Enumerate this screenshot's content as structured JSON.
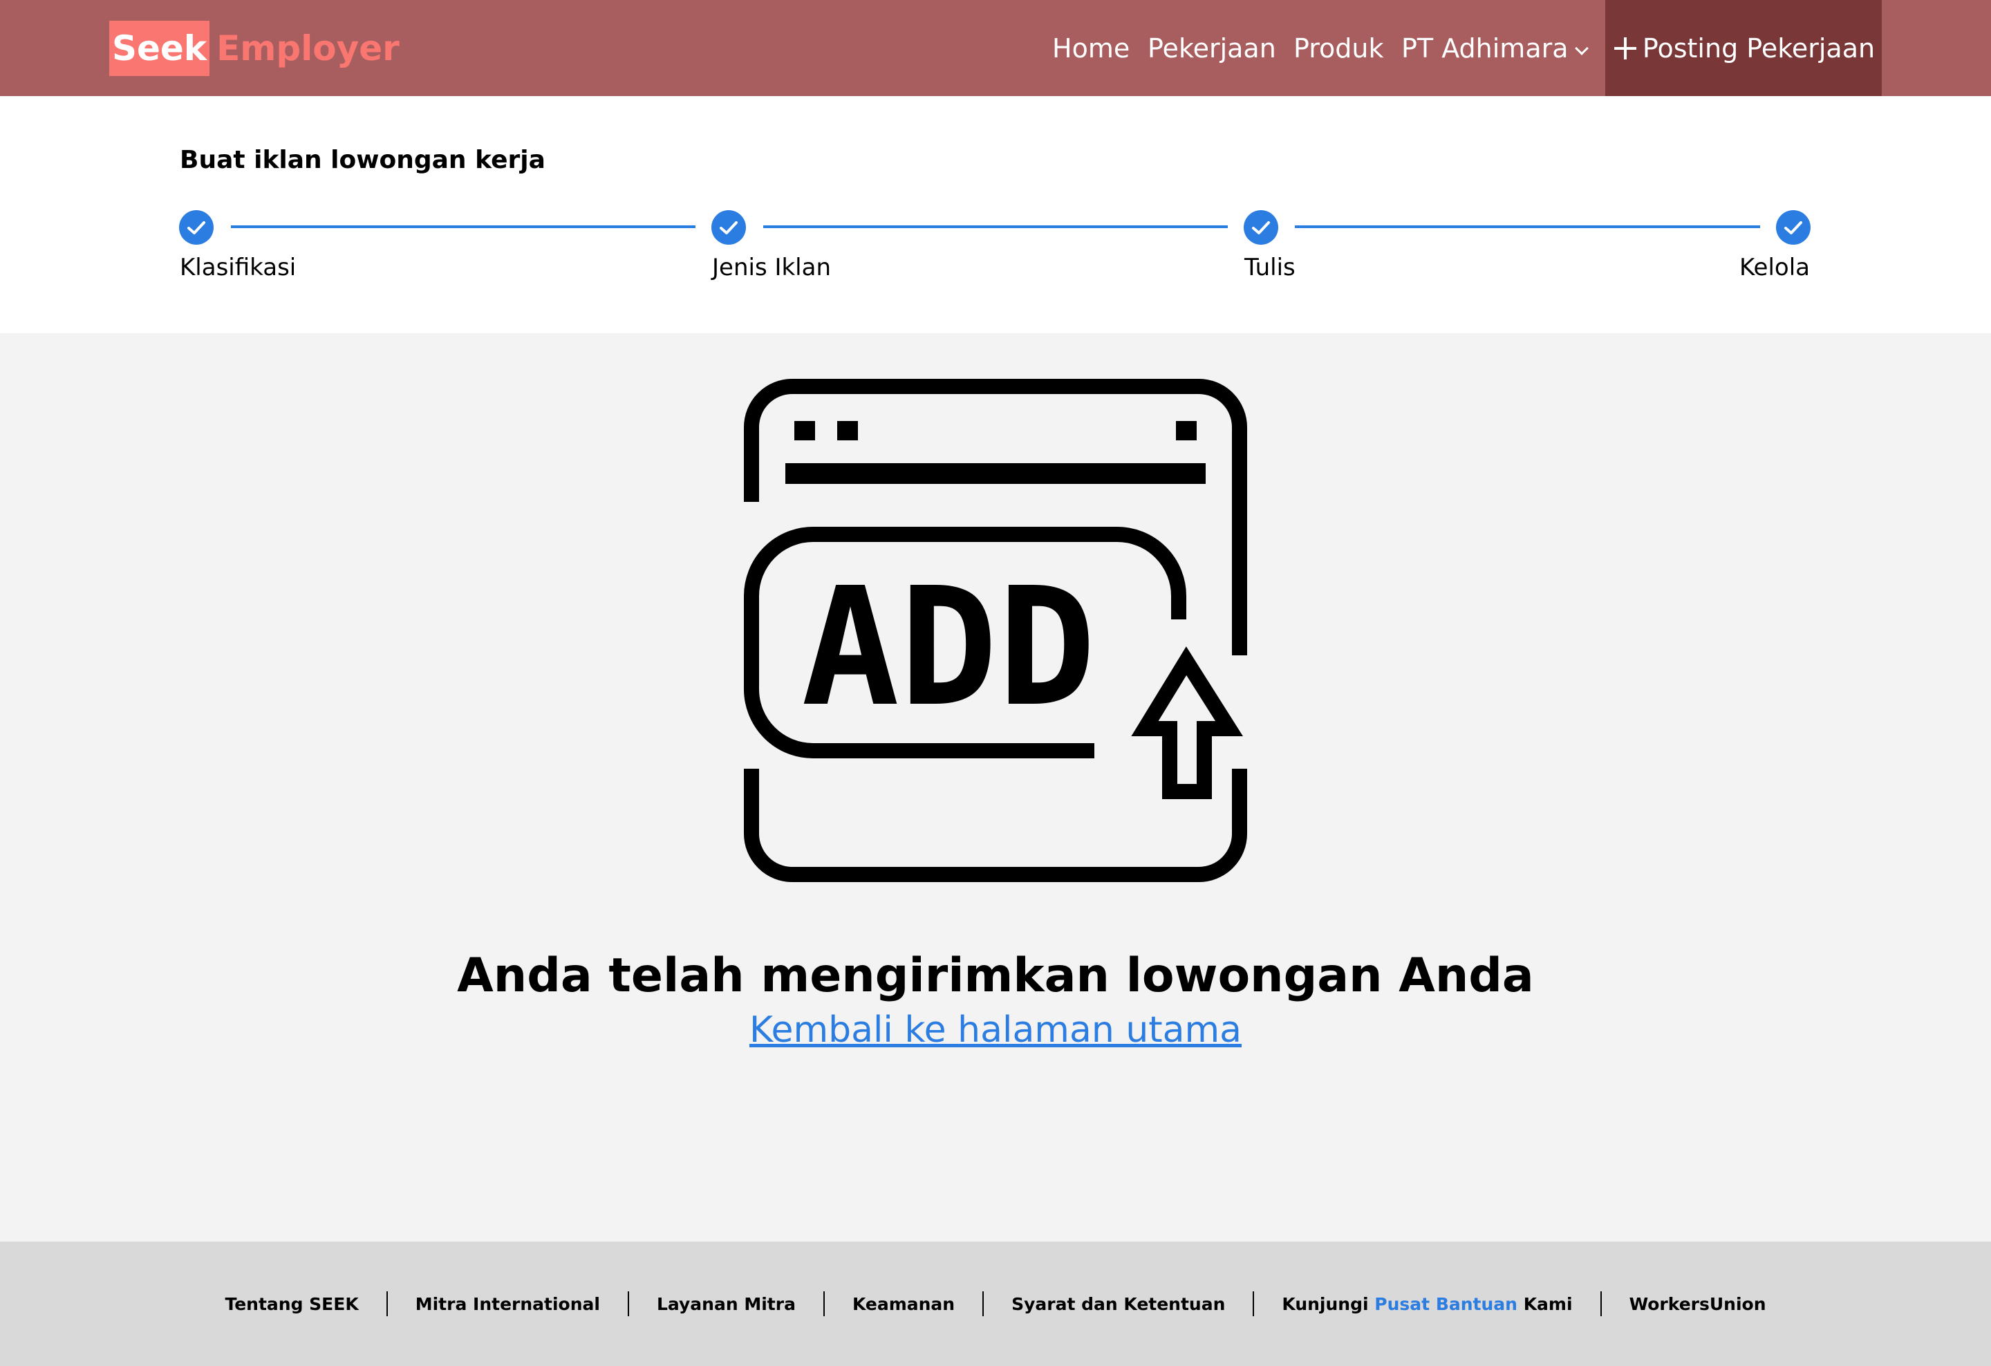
{
  "header": {
    "logo_left": "Seek",
    "logo_right": "Employer",
    "nav": {
      "home": "Home",
      "jobs": "Pekerjaan",
      "products": "Produk",
      "company": "PT Adhimara"
    },
    "post_button": "Posting Pekerjaan"
  },
  "stepper": {
    "title": "Buat iklan lowongan kerja",
    "steps": [
      {
        "label": "Klasifikasi",
        "status": "complete"
      },
      {
        "label": "Jenis Iklan",
        "status": "complete"
      },
      {
        "label": "Tulis",
        "status": "complete"
      },
      {
        "label": "Kelola",
        "status": "complete"
      }
    ]
  },
  "main": {
    "icon": "add-upload-icon",
    "icon_text": "ADD",
    "message": "Anda telah mengirimkan lowongan Anda",
    "back_link": "Kembali ke halaman utama"
  },
  "footer": {
    "links": {
      "about": "Tentang SEEK",
      "intl": "Mitra International",
      "services": "Layanan Mitra",
      "security": "Keamanan",
      "terms": "Syarat dan Ketentuan",
      "help_prefix": "Kunjungi",
      "help_link": "Pusat Bantuan",
      "help_suffix": "Kami",
      "union": "WorkersUnion"
    }
  },
  "colors": {
    "header_bg": "#a85e5f",
    "post_button_bg": "#7a3738",
    "logo_accent": "#fa7670",
    "step_blue": "#2b7de1",
    "main_bg": "#f3f3f3",
    "footer_bg": "#d9d9d9"
  }
}
